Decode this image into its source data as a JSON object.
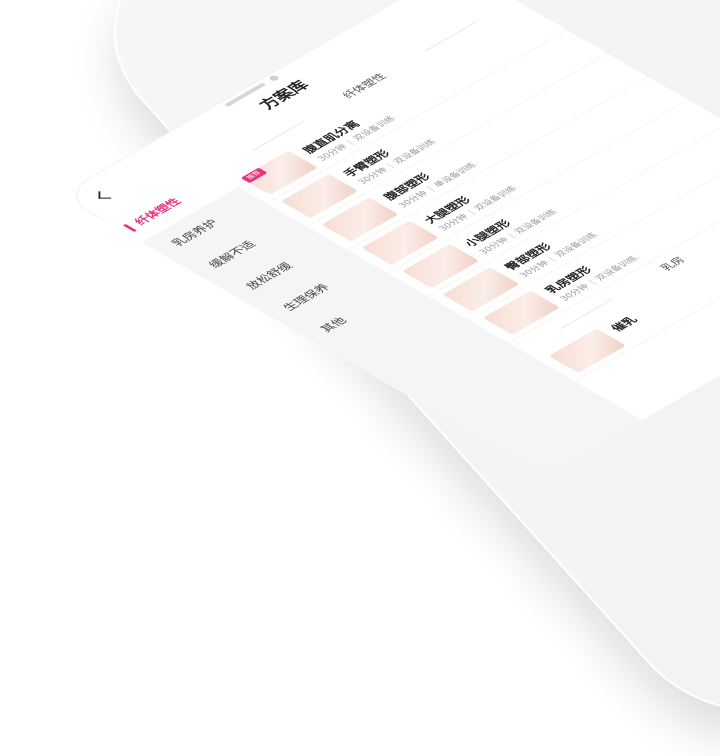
{
  "header": {
    "title": "方案库"
  },
  "sidebar": {
    "items": [
      {
        "label": "纤体塑性",
        "active": true
      },
      {
        "label": "乳房养护",
        "active": false
      },
      {
        "label": "缓解不适",
        "active": false
      },
      {
        "label": "放松舒缓",
        "active": false
      },
      {
        "label": "生理保养",
        "active": false
      },
      {
        "label": "其他",
        "active": false
      }
    ]
  },
  "content": {
    "section_title": "纤体塑性",
    "section_title_2": "乳房",
    "items": [
      {
        "name": "腹直肌分离",
        "duration": "30分钟",
        "device": "双设备训练",
        "badge": "推荐"
      },
      {
        "name": "手臂塑形",
        "duration": "30分钟",
        "device": "双设备训练",
        "badge": ""
      },
      {
        "name": "腹部塑形",
        "duration": "30分钟",
        "device": "单设备训练",
        "badge": ""
      },
      {
        "name": "大腿塑形",
        "duration": "30分钟",
        "device": "双设备训练",
        "badge": ""
      },
      {
        "name": "小腿塑形",
        "duration": "30分钟",
        "device": "双设备训练",
        "badge": ""
      },
      {
        "name": "臀部塑形",
        "duration": "30分钟",
        "device": "双设备训练",
        "badge": ""
      },
      {
        "name": "乳房塑形",
        "duration": "30分钟",
        "device": "双设备训练",
        "badge": ""
      },
      {
        "name": "催乳",
        "duration": "",
        "device": "",
        "badge": ""
      }
    ]
  },
  "colors": {
    "accent": "#e8327c",
    "sidebar_bg": "#f5f5f5"
  }
}
